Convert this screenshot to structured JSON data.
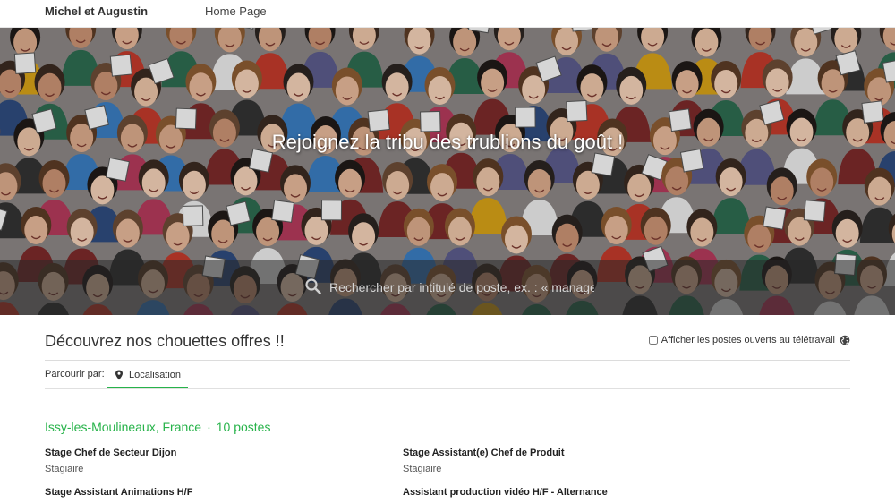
{
  "nav": {
    "brand": "Michel et Augustin",
    "home_link": "Home Page"
  },
  "hero": {
    "title": "Rejoignez la tribu des trublions du goût !",
    "search_placeholder": "Rechercher par intitulé de poste, ex. : « manage"
  },
  "listings": {
    "section_title": "Découvrez nos chouettes offres !!",
    "remote_label": "Afficher les postes ouverts au télétravail",
    "browse_label": "Parcourir par:",
    "tab_location": "Localisation",
    "location_name": "Issy-les-Moulineaux, France",
    "location_sep": "·",
    "location_count": "10 postes",
    "jobs": [
      {
        "title": "Stage Chef de Secteur Dijon",
        "type": "Stagiaire"
      },
      {
        "title": "Stage Assistant(e) Chef de Produit",
        "type": "Stagiaire"
      },
      {
        "title": "Stage Assistant Animations H/F",
        "type": ""
      },
      {
        "title": "Assistant production vidéo H/F - Alternance",
        "type": ""
      }
    ]
  },
  "colors": {
    "accent": "#27b34a"
  }
}
